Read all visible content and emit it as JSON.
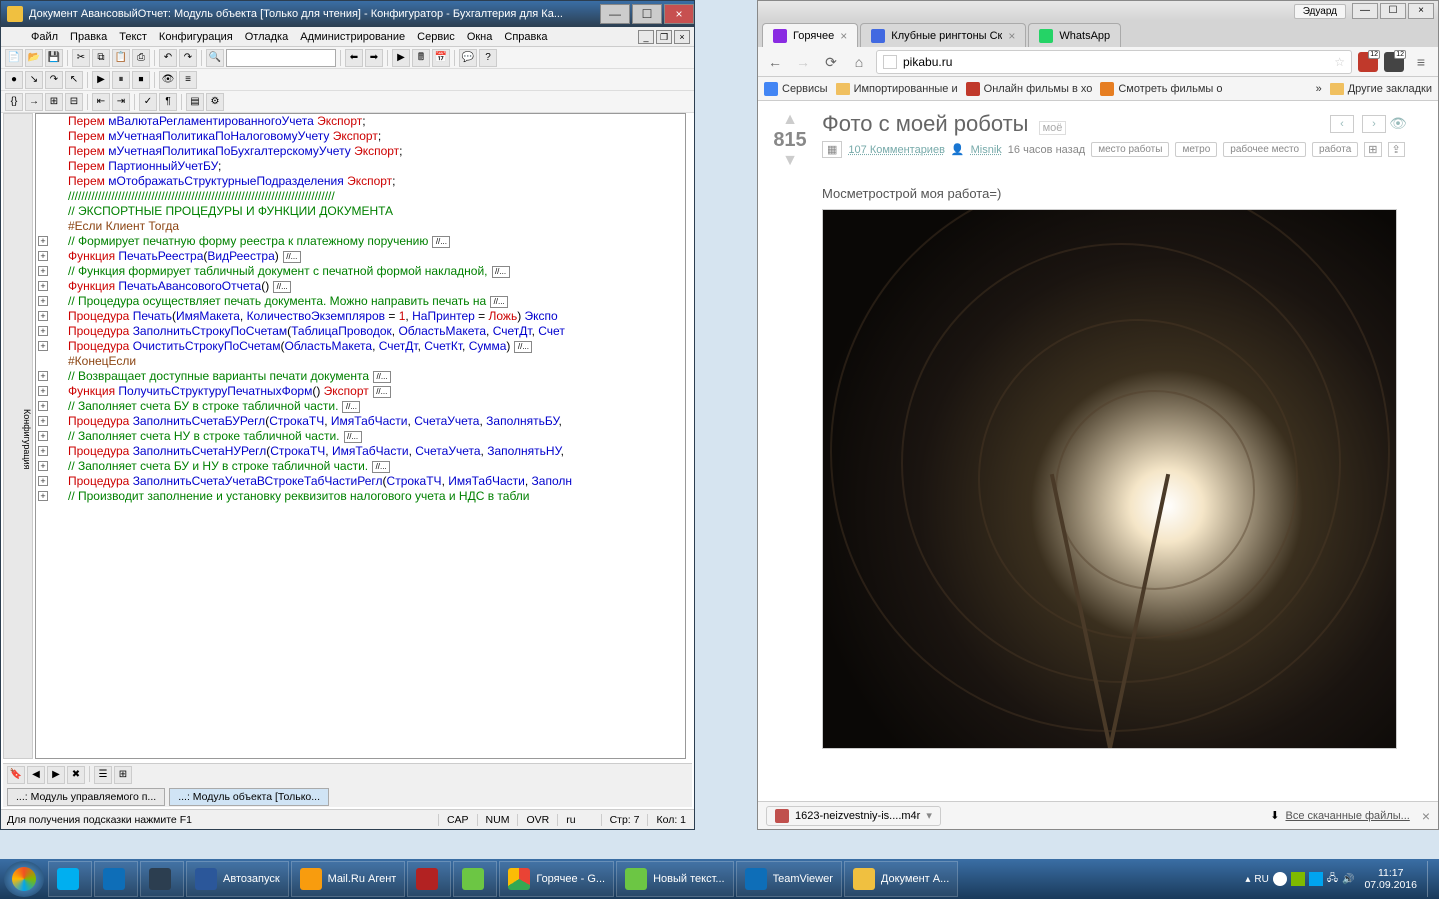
{
  "left": {
    "title": "Документ АвансовыйОтчет: Модуль объекта [Только для чтения] - Конфигуратор - Бухгалтерия для Ка...",
    "menu": [
      "Файл",
      "Правка",
      "Текст",
      "Конфигурация",
      "Отладка",
      "Администрирование",
      "Сервис",
      "Окна",
      "Справка"
    ],
    "sidebar_tab": "Конфигурация",
    "code": [
      {
        "t": "",
        "ind": 0
      },
      {
        "t": "Перем мВалютаРегламентированногоУчета Экспорт;",
        "cls": "decl",
        "ind": 1
      },
      {
        "t": "",
        "ind": 0
      },
      {
        "t": "Перем мУчетнаяПолитикаПоНалоговомуУчету Экспорт;",
        "cls": "decl",
        "ind": 1
      },
      {
        "t": "Перем мУчетнаяПолитикаПоБухгалтерскомуУчету Экспорт;",
        "cls": "decl",
        "ind": 1
      },
      {
        "t": "",
        "ind": 0
      },
      {
        "t": "Перем ПартионныйУчетБУ;",
        "cls": "decl",
        "ind": 1
      },
      {
        "t": "",
        "ind": 0
      },
      {
        "t": "Перем мОтображатьСтруктурныеПодразделения Экспорт;",
        "cls": "decl",
        "ind": 1
      },
      {
        "t": "",
        "ind": 0
      },
      {
        "t": "////////////////////////////////////////////////////////////////////////////////",
        "cls": "comment",
        "ind": 1
      },
      {
        "t": "// ЭКСПОРТНЫЕ ПРОЦЕДУРЫ И ФУНКЦИИ ДОКУМЕНТА",
        "cls": "comment",
        "ind": 1
      },
      {
        "t": "",
        "ind": 0
      },
      {
        "t": "#Если Клиент Тогда",
        "cls": "pre",
        "ind": 1
      },
      {
        "t": "// Формирует печатную форму реестра к платежному поручению",
        "cls": "comment",
        "fold": true,
        "ind": 1,
        "exp": true
      },
      {
        "t": "Функция ПечатьРеестра(ВидРеестра)",
        "cls": "func",
        "fold": true,
        "ind": 1,
        "exp": true
      },
      {
        "t": "",
        "ind": 0
      },
      {
        "t": "// Функция формирует табличный документ с печатной формой накладной,",
        "cls": "comment",
        "fold": true,
        "ind": 1,
        "exp": true
      },
      {
        "t": "Функция ПечатьАвансовогоОтчета()",
        "cls": "func",
        "fold": true,
        "ind": 1,
        "exp": true
      },
      {
        "t": "",
        "ind": 0
      },
      {
        "t": "// Процедура осуществляет печать документа. Можно направить печать на",
        "cls": "comment",
        "fold": true,
        "ind": 1,
        "exp": true
      },
      {
        "t": "Процедура Печать(ИмяМакета, КоличествоЭкземпляров = 1, НаПринтер = Ложь) Экспо",
        "cls": "proc",
        "ind": 1,
        "exp": true
      },
      {
        "t": "",
        "ind": 0
      },
      {
        "t": "Процедура ЗаполнитьСтрокуПоСчетам(ТаблицаПроводок, ОбластьМакета, СчетДт, Счет",
        "cls": "proc",
        "ind": 1,
        "exp": true
      },
      {
        "t": "",
        "ind": 0
      },
      {
        "t": "Процедура ОчиститьСтрокуПоСчетам(ОбластьМакета, СчетДт, СчетКт, Сумма)",
        "cls": "proc",
        "fold": true,
        "ind": 1,
        "exp": true
      },
      {
        "t": "",
        "ind": 0
      },
      {
        "t": "#КонецЕсли",
        "cls": "pre",
        "ind": 1
      },
      {
        "t": "",
        "ind": 0
      },
      {
        "t": "// Возвращает доступные варианты печати документа",
        "cls": "comment",
        "fold": true,
        "ind": 1,
        "exp": true
      },
      {
        "t": "Функция ПолучитьСтруктуруПечатныхФорм() Экспорт",
        "cls": "func",
        "fold": true,
        "ind": 1,
        "exp": true
      },
      {
        "t": "",
        "ind": 0
      },
      {
        "t": "// Заполняет счета БУ в строке табличной части.",
        "cls": "comment",
        "fold": true,
        "ind": 1,
        "exp": true
      },
      {
        "t": "Процедура ЗаполнитьСчетаБУРегл(СтрокаТЧ, ИмяТабЧасти, СчетаУчета, ЗаполнятьБУ,",
        "cls": "proc",
        "ind": 1,
        "exp": true
      },
      {
        "t": "",
        "ind": 0
      },
      {
        "t": "// Заполняет счета НУ в строке табличной части.",
        "cls": "comment",
        "fold": true,
        "ind": 1,
        "exp": true
      },
      {
        "t": "Процедура ЗаполнитьСчетаНУРегл(СтрокаТЧ, ИмяТабЧасти, СчетаУчета, ЗаполнятьНУ,",
        "cls": "proc",
        "ind": 1,
        "exp": true
      },
      {
        "t": "",
        "ind": 0
      },
      {
        "t": "// Заполняет счета БУ и НУ в строке табличной части.",
        "cls": "comment",
        "fold": true,
        "ind": 1,
        "exp": true
      },
      {
        "t": "Процедура ЗаполнитьСчетаУчетаВСтрокеТабЧастиРегл(СтрокаТЧ, ИмяТабЧасти, Заполн",
        "cls": "proc",
        "ind": 1,
        "exp": true
      },
      {
        "t": "",
        "ind": 0
      },
      {
        "t": "// Производит заполнение и установку реквизитов налогового учета и НДС в табли",
        "cls": "comment",
        "ind": 1,
        "exp": true
      }
    ],
    "tabs": [
      "...: Модуль управляемого п...",
      "...: Модуль объекта [Только..."
    ],
    "active_tab": 1,
    "status_hint": "Для получения подсказки нажмите F1",
    "status": {
      "cap": "CAP",
      "num": "NUM",
      "ovr": "OVR",
      "lang": "ru",
      "row": "Стр: 7",
      "col": "Кол: 1"
    }
  },
  "right": {
    "user": "Эдуард",
    "tabs": [
      {
        "label": "Горячее",
        "fav": "fav-pikabu",
        "active": true,
        "close": "×"
      },
      {
        "label": "Клубные рингтоны Ск",
        "fav": "fav-ring",
        "active": false,
        "close": "×"
      },
      {
        "label": "WhatsApp",
        "fav": "fav-whatsapp",
        "active": false,
        "close": ""
      }
    ],
    "url": "pikabu.ru",
    "ext_badges": [
      "12",
      "12"
    ],
    "bookmarks": [
      {
        "label": "Сервисы",
        "type": "app"
      },
      {
        "label": "Импортированные и",
        "type": "folder"
      },
      {
        "label": "Онлайн фильмы в хо",
        "type": "fav"
      },
      {
        "label": "Смотреть фильмы о",
        "type": "fav"
      },
      {
        "label": "»",
        "type": "more"
      },
      {
        "label": "Другие закладки",
        "type": "folder"
      }
    ],
    "post": {
      "score": "815",
      "title": "Фото с моей роботы",
      "mytag": "моё",
      "comments": "107 Комментариев",
      "author": "Misnik",
      "age": "16 часов назад",
      "tags": [
        "место работы",
        "метро",
        "рабочее место",
        "работа"
      ],
      "body": "Мосметрострой моя работа=)"
    },
    "download": {
      "file": "1623-neizvestniy-is....m4r",
      "all": "Все скачанные файлы...",
      "close": "×"
    }
  },
  "taskbar": {
    "items": [
      {
        "ico": "ico-skype",
        "lbl": ""
      },
      {
        "ico": "ico-tv",
        "lbl": ""
      },
      {
        "ico": "ico-fs",
        "lbl": ""
      },
      {
        "ico": "ico-word",
        "lbl": "Автозапуск"
      },
      {
        "ico": "ico-mail",
        "lbl": "Mail.Ru Агент"
      },
      {
        "ico": "ico-opera",
        "lbl": ""
      },
      {
        "ico": "ico-np",
        "lbl": ""
      },
      {
        "ico": "ico-chrome",
        "lbl": "Горячее - G..."
      },
      {
        "ico": "ico-np",
        "lbl": "Новый текст..."
      },
      {
        "ico": "ico-tv",
        "lbl": "TeamViewer"
      },
      {
        "ico": "ico-1c",
        "lbl": "Документ А..."
      }
    ],
    "tray_lang": "RU",
    "time": "11:17",
    "date": "07.09.2016"
  }
}
